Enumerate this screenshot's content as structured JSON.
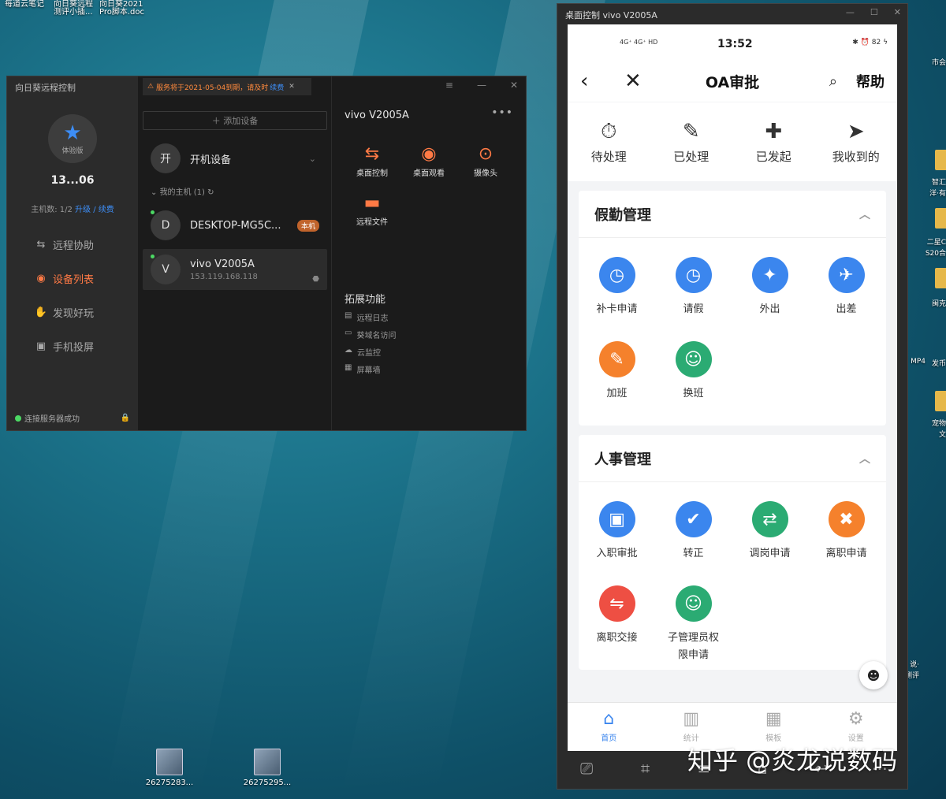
{
  "desktop": {
    "top_texts": [
      "每道云笔记",
      "向日葵远程",
      "向日葵2021",
      "测评小插...",
      "Pro脚本.doc"
    ],
    "files": [
      {
        "name": "26275283..."
      },
      {
        "name": "26275295..."
      }
    ],
    "right_labels": [
      "市会",
      "智汇",
      "洋·有",
      "二星C",
      "S20合",
      "闽克",
      "MP4",
      "发币",
      "宠物",
      "文",
      "说·",
      "测评"
    ]
  },
  "sunlogin": {
    "app_title": "向日葵远程控制",
    "version": "体验版",
    "account": "13...06",
    "hosts_label": "主机数: 1/2",
    "upgrade": "升级",
    "sep": "/",
    "renew": "续费",
    "nav": [
      {
        "label": "远程协助",
        "icon": "⇆"
      },
      {
        "label": "设备列表",
        "icon": "◉"
      },
      {
        "label": "发现好玩",
        "icon": "✋"
      },
      {
        "label": "手机投屏",
        "icon": "▣"
      }
    ],
    "connection": "连接服务器成功",
    "notice": "服务将于2021-05-04到期，请及时",
    "notice_link": "续费",
    "add_device": "＋ 添加设备",
    "boot_device": {
      "avatar": "开",
      "name": "开机设备"
    },
    "group": "我的主机 (1)",
    "devices": [
      {
        "avatar": "D",
        "name": "DESKTOP-MG5C...",
        "badge": "本机"
      },
      {
        "avatar": "V",
        "name": "vivo V2005A",
        "ip": "153.119.168.118"
      }
    ],
    "selected_device": "vivo V2005A",
    "functions": [
      {
        "label": "桌面控制",
        "icon": "⇆"
      },
      {
        "label": "桌面观看",
        "icon": "◉"
      },
      {
        "label": "摄像头",
        "icon": "⊙"
      },
      {
        "label": "远程文件",
        "icon": "▬"
      }
    ],
    "ext_title": "拓展功能",
    "ext_items": [
      {
        "label": "远程日志",
        "icon": "▤"
      },
      {
        "label": "葵域名访问",
        "icon": "▭"
      },
      {
        "label": "云监控",
        "icon": "☁"
      },
      {
        "label": "屏幕墙",
        "icon": "▦"
      }
    ]
  },
  "phone_window": {
    "title": "桌面控制 vivo V2005A",
    "status": {
      "network": "4G⁺ 4G⁺ HD",
      "time": "13:52",
      "right": "✱ ⏰ 82 ϟ"
    },
    "app_title": "OA审批",
    "help": "帮助",
    "quick": [
      {
        "label": "待处理",
        "icon": "⏱"
      },
      {
        "label": "已处理",
        "icon": "✎"
      },
      {
        "label": "已发起",
        "icon": "✚"
      },
      {
        "label": "我收到的",
        "icon": "➤"
      }
    ],
    "sections": [
      {
        "title": "假勤管理",
        "items": [
          {
            "label": "补卡申请",
            "icon": "◷",
            "color": "blue"
          },
          {
            "label": "请假",
            "icon": "◷",
            "color": "blue"
          },
          {
            "label": "外出",
            "icon": "✦",
            "color": "blue"
          },
          {
            "label": "出差",
            "icon": "✈",
            "color": "blue"
          },
          {
            "label": "加班",
            "icon": "✎",
            "color": "orange"
          },
          {
            "label": "换班",
            "icon": "☺",
            "color": "green"
          }
        ]
      },
      {
        "title": "人事管理",
        "items": [
          {
            "label": "入职审批",
            "icon": "▣",
            "color": "blue"
          },
          {
            "label": "转正",
            "icon": "✔",
            "color": "blue"
          },
          {
            "label": "调岗申请",
            "icon": "⇄",
            "color": "green"
          },
          {
            "label": "离职申请",
            "icon": "✖",
            "color": "orange"
          },
          {
            "label": "离职交接",
            "icon": "⇋",
            "color": "red"
          },
          {
            "label": "子管理员权限申请",
            "icon": "☺",
            "color": "green"
          }
        ]
      }
    ],
    "tabs": [
      {
        "label": "首页",
        "icon": "⌂",
        "active": true
      },
      {
        "label": "统计",
        "icon": "▥"
      },
      {
        "label": "模板",
        "icon": "▦"
      },
      {
        "label": "设置",
        "icon": "⚙"
      }
    ]
  },
  "watermark": "知乎 @炎龙说数码"
}
